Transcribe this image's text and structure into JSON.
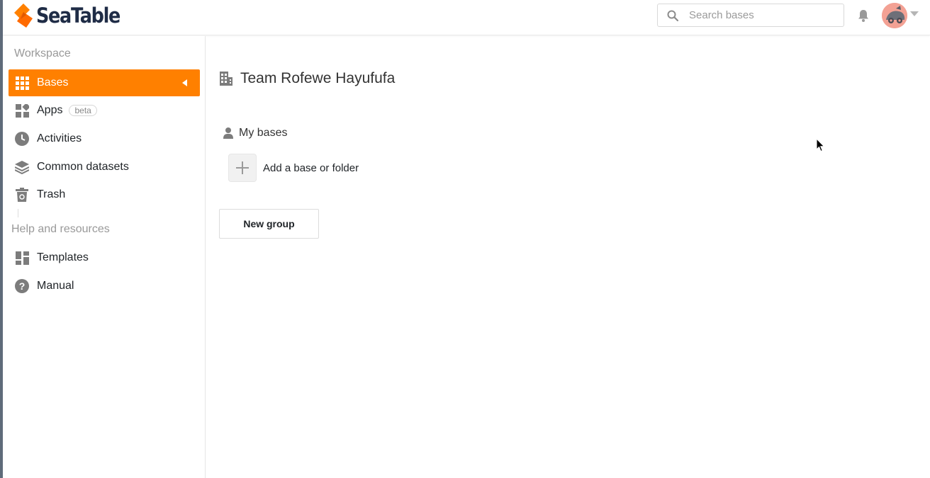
{
  "header": {
    "logo_text": "SeaTable",
    "search_placeholder": "Search bases",
    "icons": {
      "search": "search-icon",
      "bell": "bell-icon",
      "avatar": "avatar",
      "caret": "chevron-down-icon"
    }
  },
  "sidebar": {
    "workspace_title": "Workspace",
    "items": [
      {
        "label": "Bases",
        "icon": "grid-icon",
        "active": true
      },
      {
        "label": "Apps",
        "icon": "apps-icon",
        "badge": "beta"
      },
      {
        "label": "Activities",
        "icon": "clock-icon"
      },
      {
        "label": "Common datasets",
        "icon": "layers-icon"
      },
      {
        "label": "Trash",
        "icon": "trash-icon"
      }
    ],
    "help_title": "Help and resources",
    "help_items": [
      {
        "label": "Templates",
        "icon": "templates-icon"
      },
      {
        "label": "Manual",
        "icon": "question-icon"
      }
    ]
  },
  "main": {
    "team_title": "Team Rofewe Hayufufa",
    "my_bases_title": "My bases",
    "add_base_label": "Add a base or folder",
    "new_group_label": "New group"
  },
  "colors": {
    "accent": "#ff8000",
    "logo_dark": "#1f2c46",
    "logo_orange": "#ff8000",
    "muted_text": "#999999"
  }
}
